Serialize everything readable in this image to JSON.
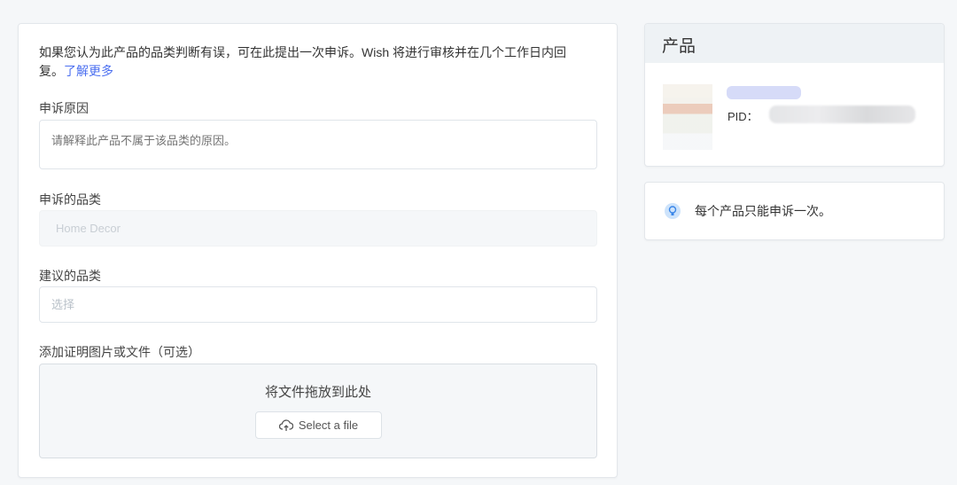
{
  "form": {
    "intro": "如果您认为此产品的品类判断有误，可在此提出一次申诉。Wish 将进行审核并在几个工作日内回复。",
    "learn_more": "了解更多",
    "reason_label": "申诉原因",
    "reason_placeholder": "请解释此产品不属于该品类的原因。",
    "category_label": "申诉的品类",
    "category_value": "Home Decor",
    "suggested_label": "建议的品类",
    "suggested_placeholder": "选择",
    "attach_label": "添加证明图片或文件（可选）",
    "drop_text": "将文件拖放到此处",
    "select_file": "Select a file"
  },
  "product": {
    "header": "产品",
    "pid_label": "PID："
  },
  "tip": {
    "text": "每个产品只能申诉一次。"
  },
  "colors": {
    "link": "#4b6ff0"
  }
}
